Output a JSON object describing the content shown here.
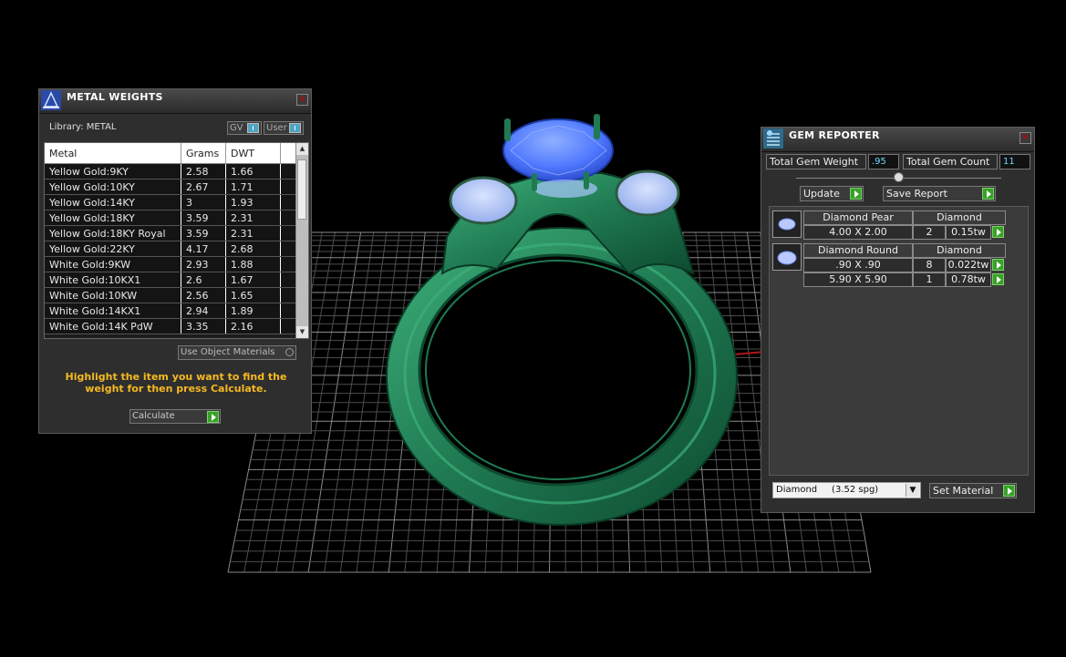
{
  "metal_weights": {
    "title": "METAL WEIGHTS",
    "library_label": "Library: METAL",
    "gv_label": "GV",
    "user_label": "User",
    "columns": [
      "Metal",
      "Grams",
      "DWT"
    ],
    "rows": [
      [
        "Yellow Gold:9KY",
        "2.58",
        "1.66"
      ],
      [
        "Yellow Gold:10KY",
        "2.67",
        "1.71"
      ],
      [
        "Yellow Gold:14KY",
        "3",
        "1.93"
      ],
      [
        "Yellow Gold:18KY",
        "3.59",
        "2.31"
      ],
      [
        "Yellow Gold:18KY Royal",
        "3.59",
        "2.31"
      ],
      [
        "Yellow Gold:22KY",
        "4.17",
        "2.68"
      ],
      [
        "White Gold:9KW",
        "2.93",
        "1.88"
      ],
      [
        "White Gold:10KX1",
        "2.6",
        "1.67"
      ],
      [
        "White Gold:10KW",
        "2.56",
        "1.65"
      ],
      [
        "White Gold:14KX1",
        "2.94",
        "1.89"
      ],
      [
        "White Gold:14K PdW",
        "3.35",
        "2.16"
      ]
    ],
    "use_object_materials": "Use Object Materials",
    "hint": "Highlight the item you want to find the weight for then press Calculate.",
    "calculate_label": "Calculate"
  },
  "gem_reporter": {
    "title": "GEM REPORTER",
    "total_weight_label": "Total Gem Weight",
    "total_weight_value": ".95",
    "total_count_label": "Total Gem Count",
    "total_count_value": "11",
    "update_label": "Update",
    "save_report_label": "Save Report",
    "groups": [
      {
        "shape": "Diamond Pear",
        "material": "Diamond",
        "sizes": [
          {
            "size": "4.00 X 2.00",
            "count": "2",
            "weight": "0.15tw"
          }
        ]
      },
      {
        "shape": "Diamond Round",
        "material": "Diamond",
        "sizes": [
          {
            "size": ".90 X .90",
            "count": "8",
            "weight": "0.022tw"
          },
          {
            "size": "5.90 X 5.90",
            "count": "1",
            "weight": "0.78tw"
          }
        ]
      }
    ],
    "material_select": "Diamond     (3.52 spg)",
    "set_material_label": "Set Material"
  },
  "colors": {
    "background": "#000000",
    "ring_metal": "#1f7a52",
    "gem": "#4f78ff",
    "hint_text": "#f5b922",
    "accent_green": "#3aa02a"
  }
}
